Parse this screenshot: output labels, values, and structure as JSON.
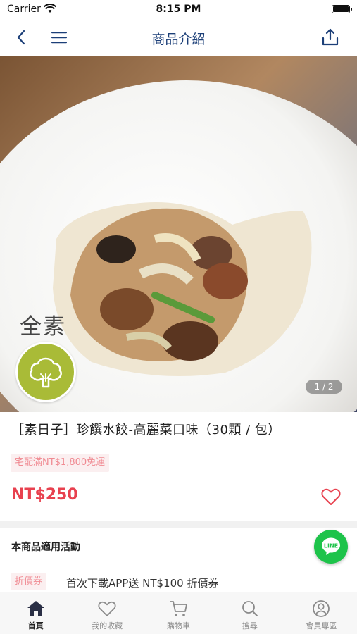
{
  "status_bar": {
    "carrier": "Carrier",
    "time": "8:15 PM"
  },
  "navbar": {
    "title": "商品介紹",
    "back_icon": "chevron-left-icon",
    "menu_icon": "hamburger-menu-icon",
    "share_icon": "share-upload-icon"
  },
  "hero": {
    "veg_label": "全素",
    "veg_icon": "broccoli-icon",
    "page_counter": "1 / 2"
  },
  "product": {
    "title": "［素日子］珍饌水餃-高麗菜口味（30顆 / 包）",
    "shipping_tag": "宅配滿NT$1,800免運",
    "price": "NT$250",
    "favorite_icon": "heart-outline-icon"
  },
  "promotions": {
    "heading": "本商品適用活動",
    "coupon_tag": "折價券",
    "coupon_text": "首次下載APP送 NT$100 折價券"
  },
  "line_button": {
    "label": "LINE"
  },
  "tabbar": {
    "items": [
      {
        "label": "首頁",
        "icon": "home-icon",
        "active": true
      },
      {
        "label": "我的收藏",
        "icon": "heart-icon",
        "active": false
      },
      {
        "label": "購物車",
        "icon": "cart-icon",
        "active": false
      },
      {
        "label": "搜尋",
        "icon": "search-icon",
        "active": false
      },
      {
        "label": "會員專區",
        "icon": "user-icon",
        "active": false
      }
    ]
  },
  "colors": {
    "accent_navy": "#1c3f78",
    "price_red": "#e8414f",
    "tag_pink": "#f08a92",
    "veg_green": "#a9bb37",
    "line_green": "#1dc34a"
  }
}
